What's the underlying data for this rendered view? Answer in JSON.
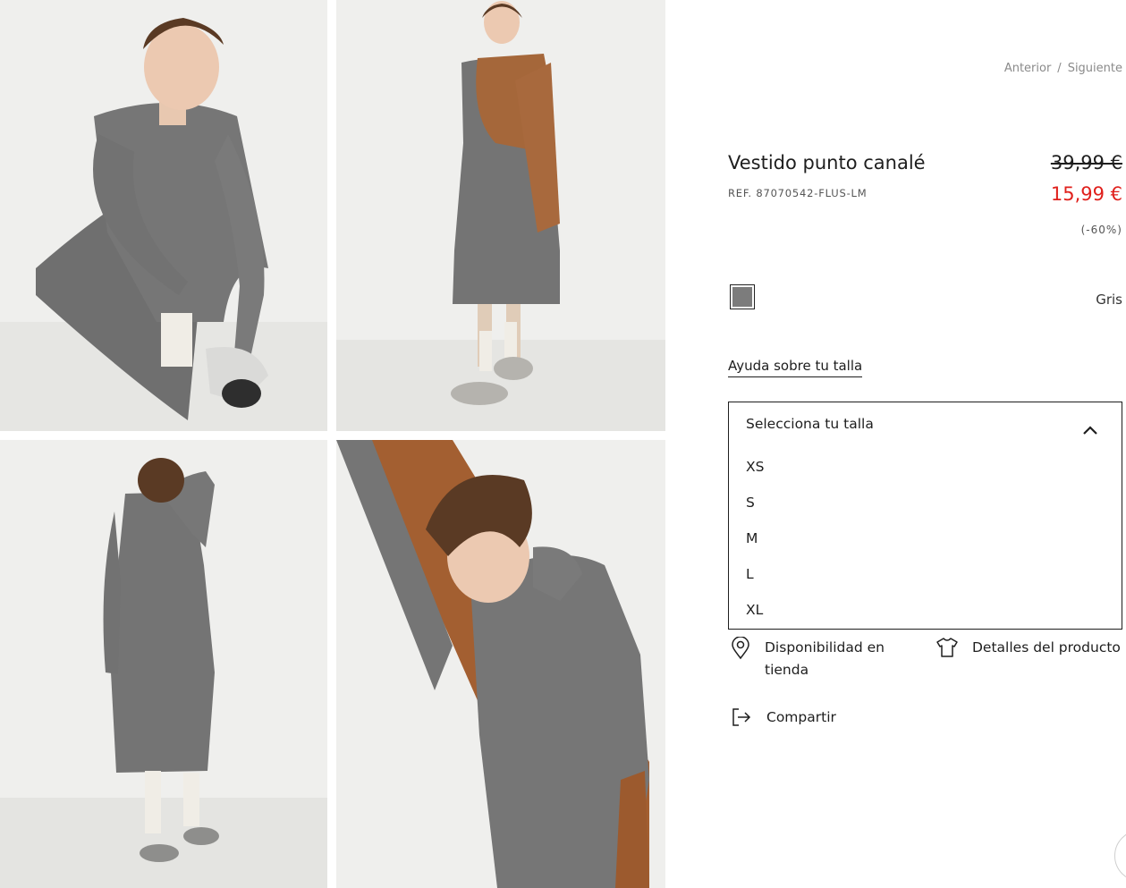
{
  "nav": {
    "prev_label": "Anterior",
    "separator": "/",
    "next_label": "Siguiente"
  },
  "product": {
    "title": "Vestido punto canalé",
    "ref": "REF. 87070542-FLUS-LM",
    "price_old": "39,99 €",
    "price_new": "15,99 €",
    "discount": "(-60%)",
    "color_name": "Gris"
  },
  "colors": {
    "sale": "#e0201c",
    "swatch": "#7c7c7c",
    "text": "#1e1e1e"
  },
  "size": {
    "help_label": "Ayuda sobre tu talla",
    "select_label": "Selecciona tu talla",
    "toggle_icon": "chevron-up-icon",
    "options": [
      "XS",
      "S",
      "M",
      "L",
      "XL"
    ]
  },
  "actions": {
    "availability_label": "Disponibilidad en tienda",
    "availability_icon": "map-pin-icon",
    "details_label": "Detalles del producto",
    "details_icon": "tshirt-icon",
    "share_label": "Compartir",
    "share_icon": "share-icon"
  }
}
